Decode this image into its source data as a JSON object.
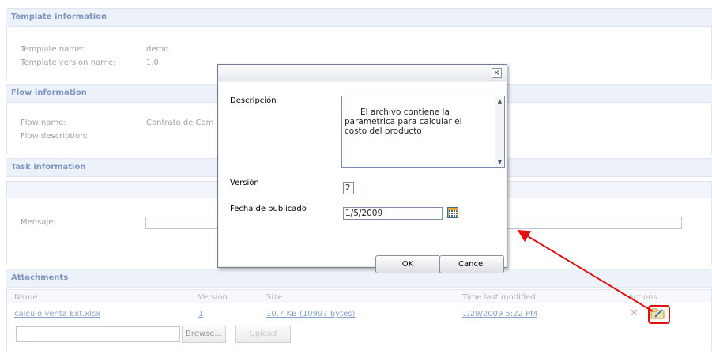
{
  "sections": {
    "template": {
      "header": "Template information",
      "name_label": "Template name:",
      "name_value": "demo",
      "version_label": "Template version name:",
      "version_value": "1.0"
    },
    "flow": {
      "header": "Flow information",
      "name_label": "Flow name:",
      "name_value": "Contrato de Com",
      "desc_label": "Flow description:"
    },
    "task": {
      "header": "Task information",
      "message_label": "Mensaje:"
    },
    "attachments": {
      "header": "Attachments",
      "columns": [
        "Name",
        "Version",
        "Size",
        "Time last modified",
        "Actions"
      ],
      "rows": [
        {
          "name": "calculo venta Ext.xlsx",
          "version": "1",
          "size": "10.7 KB (10997 bytes)",
          "modified": "1/29/2009 5:22 PM"
        }
      ],
      "browse_label": "Browse...",
      "upload_label": "Upload"
    }
  },
  "dialog": {
    "close_glyph": "×",
    "description_label": "Descripción",
    "description_value": "El archivo contiene la\nparametrica para calcular el\ncosto del producto",
    "version_label": "Versión",
    "version_value": "2",
    "date_label": "Fecha de publicado",
    "date_value": "1/5/2009",
    "ok_label": "OK",
    "cancel_label": "Cancel"
  },
  "icons": {
    "close": "close-icon",
    "calendar": "calendar-icon",
    "delete": "delete-icon",
    "edit": "edit-icon"
  },
  "colors": {
    "annotation": "#e01010",
    "header_text": "#15428b",
    "link": "#2a55a0"
  }
}
